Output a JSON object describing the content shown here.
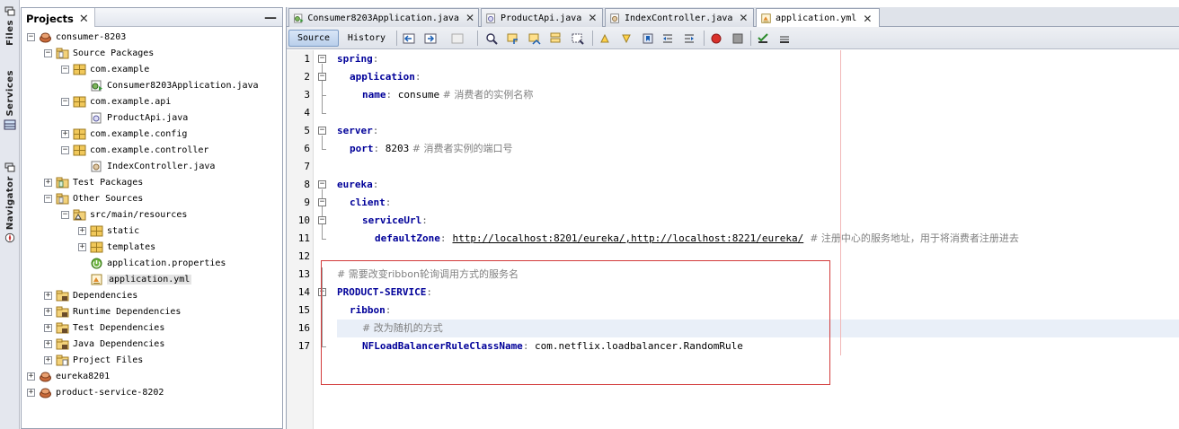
{
  "side_strip": {
    "tabs": [
      {
        "label": "Files",
        "icon": "files-icon"
      },
      {
        "label": "Services",
        "icon": "services-icon"
      },
      {
        "label": "Navigator",
        "icon": "navigator-icon"
      }
    ]
  },
  "projects_panel": {
    "title": "Projects",
    "close": "✕",
    "minimize": "—",
    "tree": [
      {
        "label": "consumer-8203",
        "icon": "maven-project-icon",
        "toggle": "−"
      },
      {
        "label": "Source Packages",
        "icon": "source-packages-icon",
        "toggle": "−"
      },
      {
        "label": "com.example",
        "icon": "package-icon",
        "toggle": "−"
      },
      {
        "label": "Consumer8203Application.java",
        "icon": "java-main-class-icon",
        "toggle": ""
      },
      {
        "label": "com.example.api",
        "icon": "package-icon",
        "toggle": "−"
      },
      {
        "label": "ProductApi.java",
        "icon": "java-interface-icon",
        "toggle": ""
      },
      {
        "label": "com.example.config",
        "icon": "package-icon",
        "toggle": "+"
      },
      {
        "label": "com.example.controller",
        "icon": "package-icon",
        "toggle": "−"
      },
      {
        "label": "IndexController.java",
        "icon": "java-class-icon",
        "toggle": ""
      },
      {
        "label": "Test Packages",
        "icon": "test-packages-icon",
        "toggle": "+"
      },
      {
        "label": "Other Sources",
        "icon": "other-sources-icon",
        "toggle": "−"
      },
      {
        "label": "src/main/resources",
        "icon": "resources-folder-icon",
        "toggle": "−"
      },
      {
        "label": "static",
        "icon": "package-icon",
        "toggle": "+"
      },
      {
        "label": "templates",
        "icon": "package-icon",
        "toggle": "+"
      },
      {
        "label": "application.properties",
        "icon": "spring-properties-icon",
        "toggle": ""
      },
      {
        "label": "application.yml",
        "icon": "yml-file-icon",
        "toggle": "",
        "selected": true
      },
      {
        "label": "Dependencies",
        "icon": "dependencies-icon",
        "toggle": "+"
      },
      {
        "label": "Runtime Dependencies",
        "icon": "dependencies-icon",
        "toggle": "+"
      },
      {
        "label": "Test Dependencies",
        "icon": "dependencies-icon",
        "toggle": "+"
      },
      {
        "label": "Java Dependencies",
        "icon": "dependencies-icon",
        "toggle": "+"
      },
      {
        "label": "Project Files",
        "icon": "project-files-icon",
        "toggle": "+"
      },
      {
        "label": "eureka8201",
        "icon": "maven-project-icon",
        "toggle": "+"
      },
      {
        "label": "product-service-8202",
        "icon": "maven-project-icon",
        "toggle": "+"
      }
    ]
  },
  "editor": {
    "tabs": [
      {
        "label": "Consumer8203Application.java",
        "icon": "java-main-class-icon",
        "close": "✕",
        "active": false
      },
      {
        "label": "ProductApi.java",
        "icon": "java-interface-icon",
        "close": "✕",
        "active": false
      },
      {
        "label": "IndexController.java",
        "icon": "java-class-icon",
        "close": "✕",
        "active": false
      },
      {
        "label": "application.yml",
        "icon": "yml-file-icon",
        "close": "✕",
        "active": true
      }
    ],
    "toolbar": {
      "source_label": "Source",
      "history_label": "History",
      "icons": [
        "last-edit-icon",
        "back-icon",
        "forward-icon",
        "find-icon",
        "find-previous-icon",
        "find-next-icon",
        "toggle-highlight-icon",
        "find-selection-icon",
        "previous-bookmark-icon",
        "next-bookmark-icon",
        "toggle-bookmark-icon",
        "shift-left-icon",
        "shift-right-icon",
        "start-macro-icon",
        "stop-macro-icon",
        "check-file-icon",
        "validate-icon"
      ]
    },
    "lines": [
      {
        "n": "1",
        "key": "spring",
        "sep": ":",
        "value": "",
        "comment": ""
      },
      {
        "n": "2",
        "key": "application",
        "sep": ":",
        "value": "",
        "comment": ""
      },
      {
        "n": "3",
        "key": "name",
        "sep": ":",
        "value": " consume",
        "comment": " # 消费者的实例名称"
      },
      {
        "n": "4",
        "key": "",
        "sep": "",
        "value": "",
        "comment": ""
      },
      {
        "n": "5",
        "key": "server",
        "sep": ":",
        "value": "",
        "comment": ""
      },
      {
        "n": "6",
        "key": "port",
        "sep": ":",
        "value": " 8203",
        "comment": " # 消费者实例的端口号"
      },
      {
        "n": "7",
        "key": "",
        "sep": "",
        "value": "",
        "comment": ""
      },
      {
        "n": "8",
        "key": "eureka",
        "sep": ":",
        "value": "",
        "comment": ""
      },
      {
        "n": "9",
        "key": "client",
        "sep": ":",
        "value": "",
        "comment": ""
      },
      {
        "n": "10",
        "key": "serviceUrl",
        "sep": ":",
        "value": "",
        "comment": ""
      },
      {
        "n": "11",
        "key": "defaultZone",
        "sep": ":",
        "value": "http://localhost:8201/eureka/,http://localhost:8221/eureka/",
        "comment": "  # 注册中心的服务地址，用于将消费者注册进去"
      },
      {
        "n": "12",
        "key": "",
        "sep": "",
        "value": "",
        "comment": ""
      },
      {
        "n": "13",
        "key": "",
        "sep": "",
        "value": "",
        "comment": "# 需要改变ribbon轮询调用方式的服务名"
      },
      {
        "n": "14",
        "key": "PRODUCT-SERVICE",
        "sep": ":",
        "value": "",
        "comment": ""
      },
      {
        "n": "15",
        "key": "ribbon",
        "sep": ":",
        "value": "",
        "comment": ""
      },
      {
        "n": "16",
        "key": "",
        "sep": "",
        "value": "",
        "comment": "# 改为随机的方式"
      },
      {
        "n": "17",
        "key": "NFLoadBalancerRuleClassName",
        "sep": ":",
        "value": " com.netflix.loadbalancer.RandomRule",
        "comment": ""
      }
    ]
  },
  "colors": {
    "key": "#000099",
    "comment": "#808080",
    "annotation_box": "#d23a3a",
    "active_source_button": "#b9cfeb",
    "current_line": "#e9eff8"
  }
}
